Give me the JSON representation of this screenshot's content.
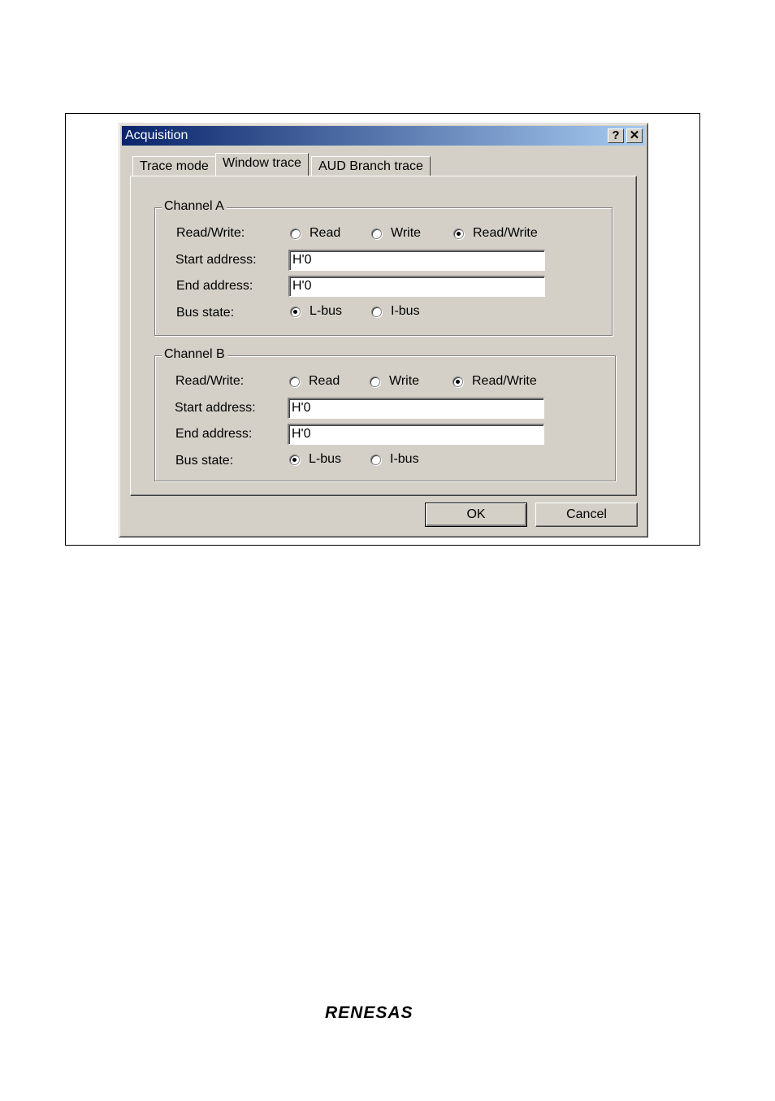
{
  "dialog": {
    "title": "Acquisition",
    "help_glyph": "?",
    "close_glyph": "✕"
  },
  "tabs": [
    {
      "label": "Trace mode",
      "active": false
    },
    {
      "label": "Window trace",
      "active": true
    },
    {
      "label": "AUD Branch trace",
      "active": false
    }
  ],
  "channel_a": {
    "title": "Channel A",
    "rw_label": "Read/Write:",
    "rw_options": [
      "Read",
      "Write",
      "Read/Write"
    ],
    "rw_selected": "Read/Write",
    "start_label": "Start address:",
    "start_value": "H'0",
    "end_label": "End address:",
    "end_value": "H'0",
    "bus_label": "Bus state:",
    "bus_options": [
      "L-bus",
      "I-bus"
    ],
    "bus_selected": "L-bus"
  },
  "channel_b": {
    "title": "Channel B",
    "rw_label": "Read/Write:",
    "rw_options": [
      "Read",
      "Write",
      "Read/Write"
    ],
    "rw_selected": "Read/Write",
    "start_label": "Start address:",
    "start_value": "H'0",
    "end_label": "End address:",
    "end_value": "H'0",
    "bus_label": "Bus state:",
    "bus_options": [
      "L-bus",
      "I-bus"
    ],
    "bus_selected": "L-bus"
  },
  "buttons": {
    "ok": "OK",
    "cancel": "Cancel"
  },
  "logo_text": "RENESAS"
}
